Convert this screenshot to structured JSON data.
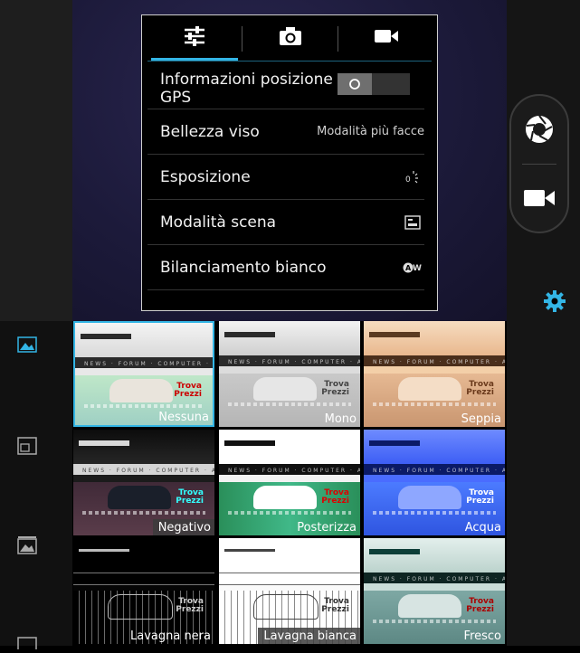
{
  "settings": {
    "tabs": [
      {
        "name": "general-settings",
        "icon": "sliders-icon",
        "active": true
      },
      {
        "name": "photo-settings",
        "icon": "camera-icon",
        "active": false
      },
      {
        "name": "video-settings",
        "icon": "video-camera-icon",
        "active": false
      }
    ],
    "rows": [
      {
        "label": "Informazioni posizione",
        "label2": "GPS",
        "control": "toggle",
        "toggle_state": "O"
      },
      {
        "label": "Bellezza viso",
        "value": "Modalità più facce"
      },
      {
        "label": "Esposizione",
        "value_icon": "exposure-icon"
      },
      {
        "label": "Modalità scena",
        "value_icon": "scene-mode-icon"
      },
      {
        "label": "Bilanciamento bianco",
        "value_icon": "auto-white-balance-icon"
      }
    ]
  },
  "controls": {
    "shutter_icon": "shutter-icon",
    "video_icon": "video-camera-icon",
    "settings_icon": "gear-icon"
  },
  "sidebar": [
    "gallery-icon",
    "frame-icon",
    "panorama-icon",
    "picture-icon"
  ],
  "effects": [
    {
      "label": "Nessuna",
      "selected": true
    },
    {
      "label": "Mono"
    },
    {
      "label": "Seppia"
    },
    {
      "label": "Negativo"
    },
    {
      "label": "Posterizza"
    },
    {
      "label": "Acqua"
    },
    {
      "label": "Lavagna nera"
    },
    {
      "label": "Lavagna bianca"
    },
    {
      "label": "Fresco"
    }
  ],
  "colors": {
    "accent": "#33b5e5",
    "panel_bg": "#000000",
    "panel_border": "#cfcfcf"
  }
}
